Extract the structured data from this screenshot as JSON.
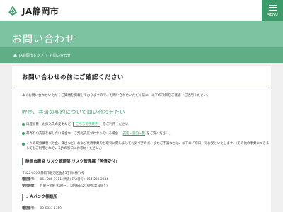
{
  "header": {
    "logo_text": "JA静岡市",
    "menu_label": "MENU"
  },
  "hero": {
    "title": "お問い合わせ"
  },
  "breadcrumb": {
    "items": [
      "JA静岡市トップ",
      "お問い合わせ"
    ]
  },
  "card": {
    "title": "お問い合わせの前にご確認ください",
    "intro": "よくお問い合わせいただくご質問を掲載しておりますので、お問い合わせいただく前に、以下の項目をご確認・ご活用ください。",
    "section_title": "貯金、共済の契約について問い合わせたい",
    "bullets": [
      {
        "pre": "口座振替・お振込先の変更など",
        "btn": "こちらで手続き",
        "post": "をご利用ください。"
      },
      {
        "pre": "最寄りの支店を探したい場合や、ご契約支店がわかっている場合、",
        "link": "支店・施設一覧",
        "post": "をご覧ください。"
      },
      {
        "pre": "ＪＡの取扱業務（貯金、貸出など）および共済事業のお取引に関しましてお気づきの点、またご不満などは、以下の「窓口」でお受けいたします。（その他の事業につきましてもご利用されているJAの窓口にお尋ねください。）"
      }
    ],
    "offices": [
      {
        "name": "静岡市農協 リスク管理部 リスク管理課「苦情受付」",
        "lines": [
          {
            "label": "",
            "value": "〒422-8506 静岡市駿河区曲金5丁目4番70号"
          },
          {
            "label": "電話番号：",
            "value": "054-285-9311 (代表) FAX番号：054-283-2044"
          },
          {
            "label": "受付時間：",
            "value": "月曜〜金曜 9:00〜17:00(祝日及びJA休業日除く)"
          }
        ]
      },
      {
        "name": "ＪＡバンク相談所",
        "lines": [
          {
            "label": "電話番号：",
            "value": "03-6837-1359"
          }
        ]
      }
    ]
  },
  "colors": {
    "brand": "#3d9a6a",
    "hero": "#7dc3a1",
    "crumbbar": "#5fae86"
  }
}
